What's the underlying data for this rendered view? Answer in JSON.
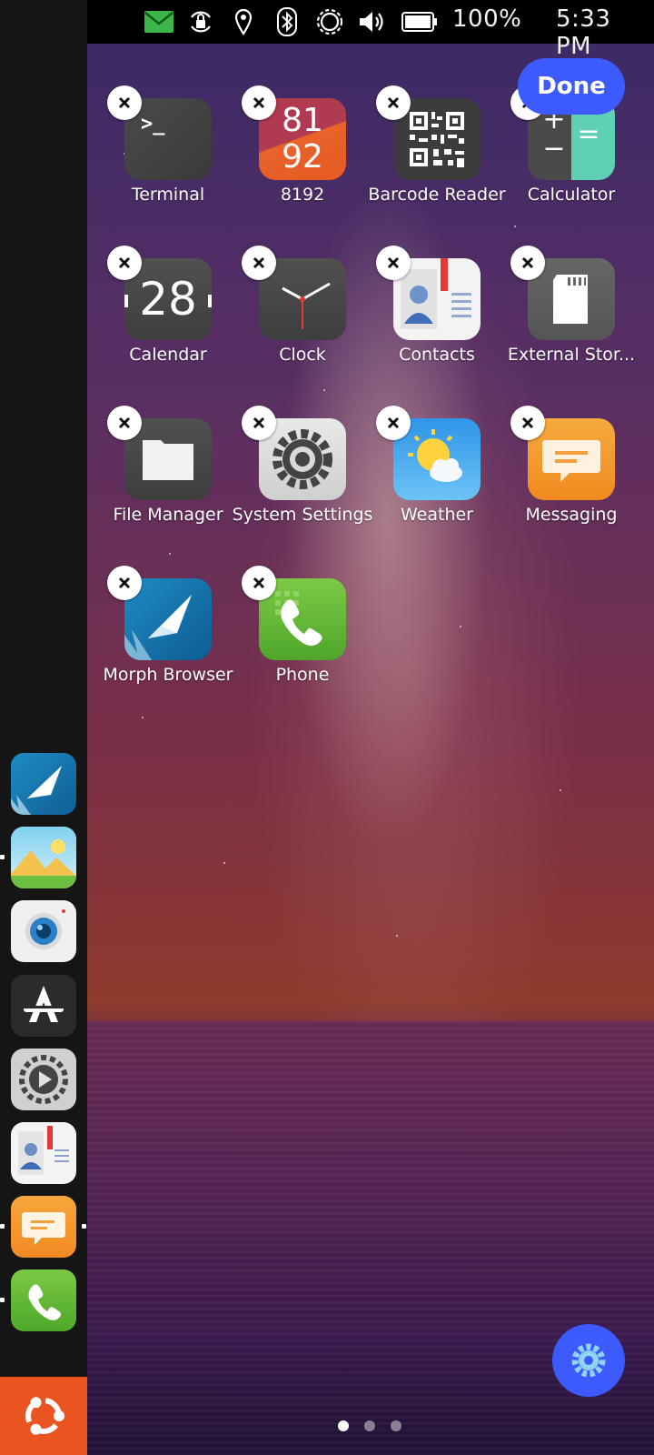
{
  "status_bar": {
    "battery_percent": "100%",
    "time": "5:33 PM",
    "icons": [
      "message-icon",
      "rotation-lock-icon",
      "location-icon",
      "bluetooth-icon",
      "brightness-icon",
      "volume-icon",
      "battery-icon"
    ]
  },
  "launcher": {
    "items": [
      "morph-browser",
      "gallery",
      "camera",
      "app-store",
      "media-player",
      "contacts",
      "messaging",
      "phone"
    ],
    "home_button": "ubuntu-logo-icon"
  },
  "edit_mode": {
    "done_label": "Done"
  },
  "apps": [
    {
      "label": "Terminal"
    },
    {
      "label": "8192"
    },
    {
      "label": "Barcode Reader"
    },
    {
      "label": "Calculator"
    },
    {
      "label": "Calendar"
    },
    {
      "label": "Clock"
    },
    {
      "label": "Contacts"
    },
    {
      "label": "External Stor..."
    },
    {
      "label": "File Manager"
    },
    {
      "label": "System Settings"
    },
    {
      "label": "Weather"
    },
    {
      "label": "Messaging"
    },
    {
      "label": "Morph Browser"
    },
    {
      "label": "Phone"
    }
  ],
  "icon_text": {
    "terminal_prompt": ">_",
    "game_top": "81",
    "game_bottom": "92",
    "calendar_day": "28",
    "calc_plus": "+",
    "calc_minus": "−",
    "calc_equals": "="
  },
  "pager": {
    "pages": 3,
    "current": 1
  },
  "colors": {
    "accent": "#3d5afe",
    "ubuntu_orange": "#e95420"
  }
}
